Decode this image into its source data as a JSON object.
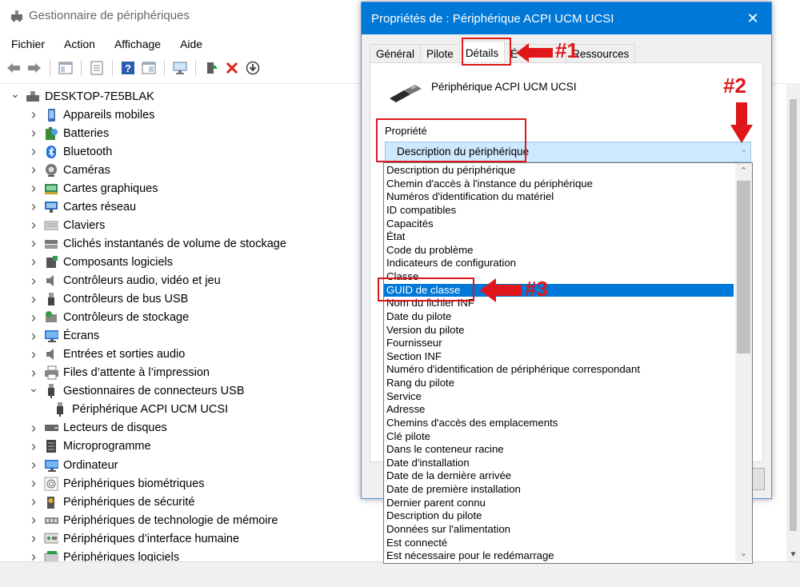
{
  "main": {
    "title": "Gestionnaire de périphériques",
    "menu": [
      "Fichier",
      "Action",
      "Affichage",
      "Aide"
    ],
    "tree": [
      {
        "label": "DESKTOP-7E5BLAK",
        "level": 0,
        "state": "expanded",
        "icon": "computer-icon"
      },
      {
        "label": "Appareils mobiles",
        "level": 1,
        "state": "collapsed",
        "icon": "mobile-device-icon"
      },
      {
        "label": "Batteries",
        "level": 1,
        "state": "collapsed",
        "icon": "battery-icon"
      },
      {
        "label": "Bluetooth",
        "level": 1,
        "state": "collapsed",
        "icon": "bluetooth-icon"
      },
      {
        "label": "Caméras",
        "level": 1,
        "state": "collapsed",
        "icon": "camera-icon"
      },
      {
        "label": "Cartes graphiques",
        "level": 1,
        "state": "collapsed",
        "icon": "display-adapter-icon"
      },
      {
        "label": "Cartes réseau",
        "level": 1,
        "state": "collapsed",
        "icon": "network-adapter-icon"
      },
      {
        "label": "Claviers",
        "level": 1,
        "state": "collapsed",
        "icon": "keyboard-icon"
      },
      {
        "label": "Clichés instantanés de volume de stockage",
        "level": 1,
        "state": "collapsed",
        "icon": "storage-snapshot-icon"
      },
      {
        "label": "Composants logiciels",
        "level": 1,
        "state": "collapsed",
        "icon": "software-component-icon"
      },
      {
        "label": "Contrôleurs audio, vidéo et jeu",
        "level": 1,
        "state": "collapsed",
        "icon": "speaker-icon"
      },
      {
        "label": "Contrôleurs de bus USB",
        "level": 1,
        "state": "collapsed",
        "icon": "usb-icon"
      },
      {
        "label": "Contrôleurs de stockage",
        "level": 1,
        "state": "collapsed",
        "icon": "storage-controller-icon"
      },
      {
        "label": "Écrans",
        "level": 1,
        "state": "collapsed",
        "icon": "monitor-icon"
      },
      {
        "label": "Entrées et sorties audio",
        "level": 1,
        "state": "collapsed",
        "icon": "speaker-icon"
      },
      {
        "label": "Files d’attente à l’impression",
        "level": 1,
        "state": "collapsed",
        "icon": "printer-icon"
      },
      {
        "label": "Gestionnaires de connecteurs USB",
        "level": 1,
        "state": "expanded",
        "icon": "usb-connector-icon"
      },
      {
        "label": "Périphérique ACPI UCM UCSI",
        "level": 2,
        "state": "leaf",
        "icon": "usb-connector-icon"
      },
      {
        "label": "Lecteurs de disques",
        "level": 1,
        "state": "collapsed",
        "icon": "disk-drive-icon"
      },
      {
        "label": "Microprogramme",
        "level": 1,
        "state": "collapsed",
        "icon": "firmware-icon"
      },
      {
        "label": "Ordinateur",
        "level": 1,
        "state": "collapsed",
        "icon": "monitor-icon"
      },
      {
        "label": "Périphériques biométriques",
        "level": 1,
        "state": "collapsed",
        "icon": "fingerprint-icon"
      },
      {
        "label": "Périphériques de sécurité",
        "level": 1,
        "state": "collapsed",
        "icon": "security-key-icon"
      },
      {
        "label": "Périphériques de technologie de mémoire",
        "level": 1,
        "state": "collapsed",
        "icon": "memory-icon"
      },
      {
        "label": "Périphériques d’interface humaine",
        "level": 1,
        "state": "collapsed",
        "icon": "hid-icon"
      },
      {
        "label": "Périphériques logiciels",
        "level": 1,
        "state": "collapsed",
        "icon": "software-device-icon"
      }
    ]
  },
  "dialog": {
    "title": "Propriétés de : Périphérique ACPI UCM UCSI",
    "close": "✕",
    "tabs": [
      {
        "label": "Général",
        "active": false
      },
      {
        "label": "Pilote",
        "active": false
      },
      {
        "label": "Détails",
        "active": true
      },
      {
        "label": "É",
        "active": false
      },
      {
        "label": "Ressources",
        "active": false
      }
    ],
    "device_name": "Périphérique ACPI UCM UCSI",
    "property_label": "Propriété",
    "selected_property": "Description du périphérique",
    "options": [
      "Description du périphérique",
      "Chemin d'accès à l'instance du périphérique",
      "Numéros d'identification du matériel",
      "ID compatibles",
      "Capacités",
      "État",
      "Code du problème",
      "Indicateurs de configuration",
      "Classe",
      "GUID de classe",
      "Nom du fichier INF",
      "Date du pilote",
      "Version du pilote",
      "Fournisseur",
      "Section INF",
      "Numéro d'identification de périphérique correspondant",
      "Rang du pilote",
      "Service",
      "Adresse",
      "Chemins d'accès des emplacements",
      "Clé pilote",
      "Dans le conteneur racine",
      "Date d'installation",
      "Date de la dernière arrivée",
      "Date de première installation",
      "Dernier parent connu",
      "Description du pilote",
      "Données sur l'alimentation",
      "Est connecté",
      "Est nécessaire pour le redémarrage"
    ],
    "highlighted_index": 9
  },
  "annotations": {
    "a1": "#1",
    "a2": "#2",
    "a3": "#3",
    "color": "#e0161b"
  }
}
